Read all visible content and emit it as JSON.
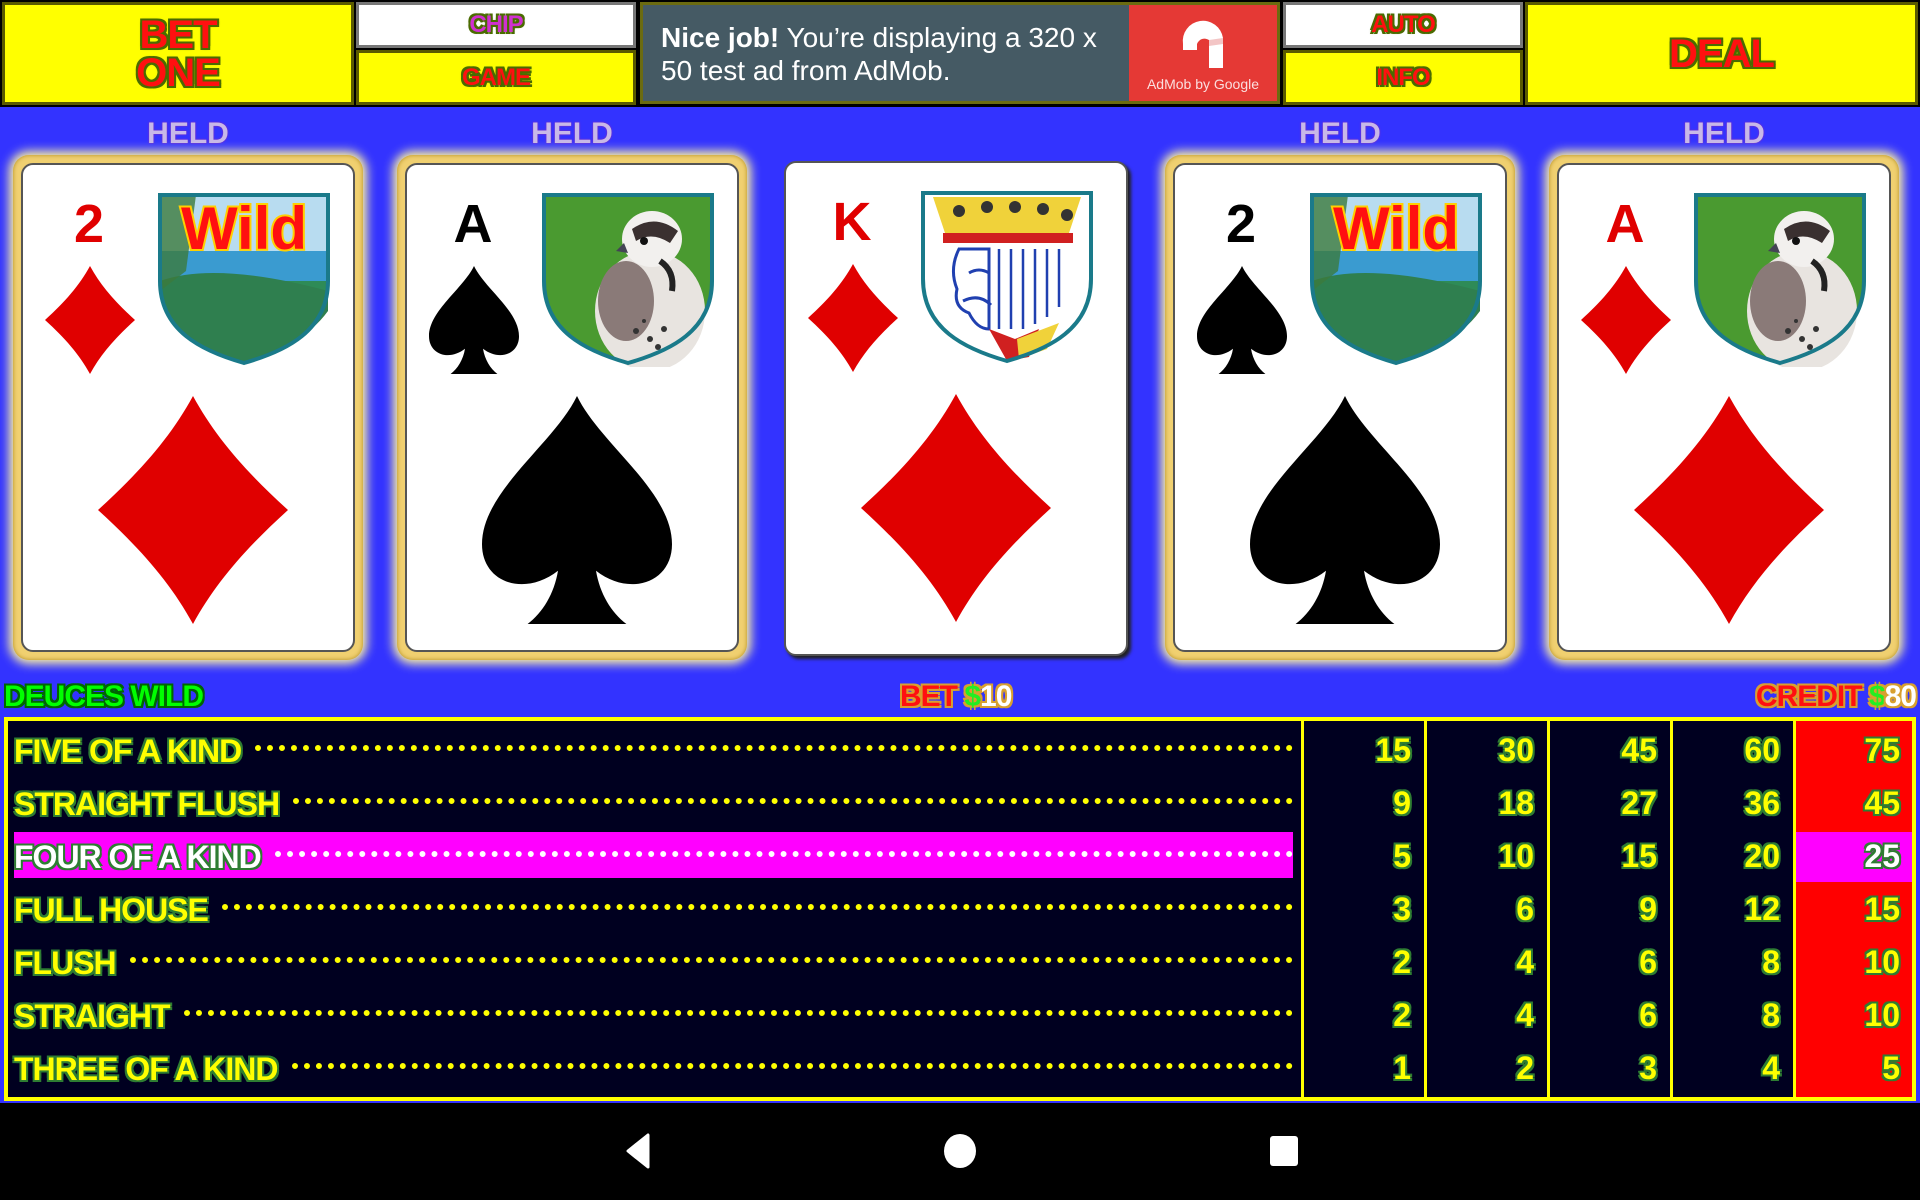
{
  "topbar": {
    "bet_one": [
      "BET",
      "ONE"
    ],
    "chip": "CHIP",
    "game": "GAME",
    "auto": "AUTO",
    "info": "INFO",
    "deal": "DEAL"
  },
  "ad": {
    "headline": "Nice job!",
    "body": "You’re displaying a 320 x 50 test ad from AdMob.",
    "logo_caption": "AdMob by Google",
    "logo_icon": "admob-logo-icon",
    "bg_color": "#455a64",
    "logo_color": "#e53935"
  },
  "hand": {
    "held_label": "HELD",
    "cards": [
      {
        "rank": "2",
        "suit": "diamonds",
        "color": "red",
        "crest": "Wild",
        "held": true
      },
      {
        "rank": "A",
        "suit": "spades",
        "color": "black",
        "crest": "falcon",
        "held": true
      },
      {
        "rank": "K",
        "suit": "diamonds",
        "color": "red",
        "crest": "king",
        "held": false
      },
      {
        "rank": "2",
        "suit": "spades",
        "color": "black",
        "crest": "Wild",
        "held": true
      },
      {
        "rank": "A",
        "suit": "diamonds",
        "color": "red",
        "crest": "falcon",
        "held": true
      }
    ]
  },
  "status": {
    "game_name": "DEUCES WILD",
    "bet_label": "BET",
    "bet_currency": "$",
    "bet_amount": "10",
    "credit_label": "CREDIT",
    "credit_currency": "$",
    "credit_amount": "80"
  },
  "paytable": {
    "active_column": 4,
    "highlighted_row": 2,
    "rows": [
      {
        "name": "FIVE OF A KIND",
        "values": [
          "15",
          "30",
          "45",
          "60",
          "75"
        ]
      },
      {
        "name": "STRAIGHT FLUSH",
        "values": [
          "9",
          "18",
          "27",
          "36",
          "45"
        ]
      },
      {
        "name": "FOUR OF A KIND",
        "values": [
          "5",
          "10",
          "15",
          "20",
          "25"
        ]
      },
      {
        "name": "FULL HOUSE",
        "values": [
          "3",
          "6",
          "9",
          "12",
          "15"
        ]
      },
      {
        "name": "FLUSH",
        "values": [
          "2",
          "4",
          "6",
          "8",
          "10"
        ]
      },
      {
        "name": "STRAIGHT",
        "values": [
          "2",
          "4",
          "6",
          "8",
          "10"
        ]
      },
      {
        "name": "THREE OF A KIND",
        "values": [
          "1",
          "2",
          "3",
          "4",
          "5"
        ]
      }
    ],
    "colors": {
      "border": "#ffff00",
      "active_col": "#ff0000",
      "highlight": "#ff00ff"
    }
  },
  "navbar": {
    "back": "back-icon",
    "home": "home-icon",
    "recents": "recents-icon"
  }
}
